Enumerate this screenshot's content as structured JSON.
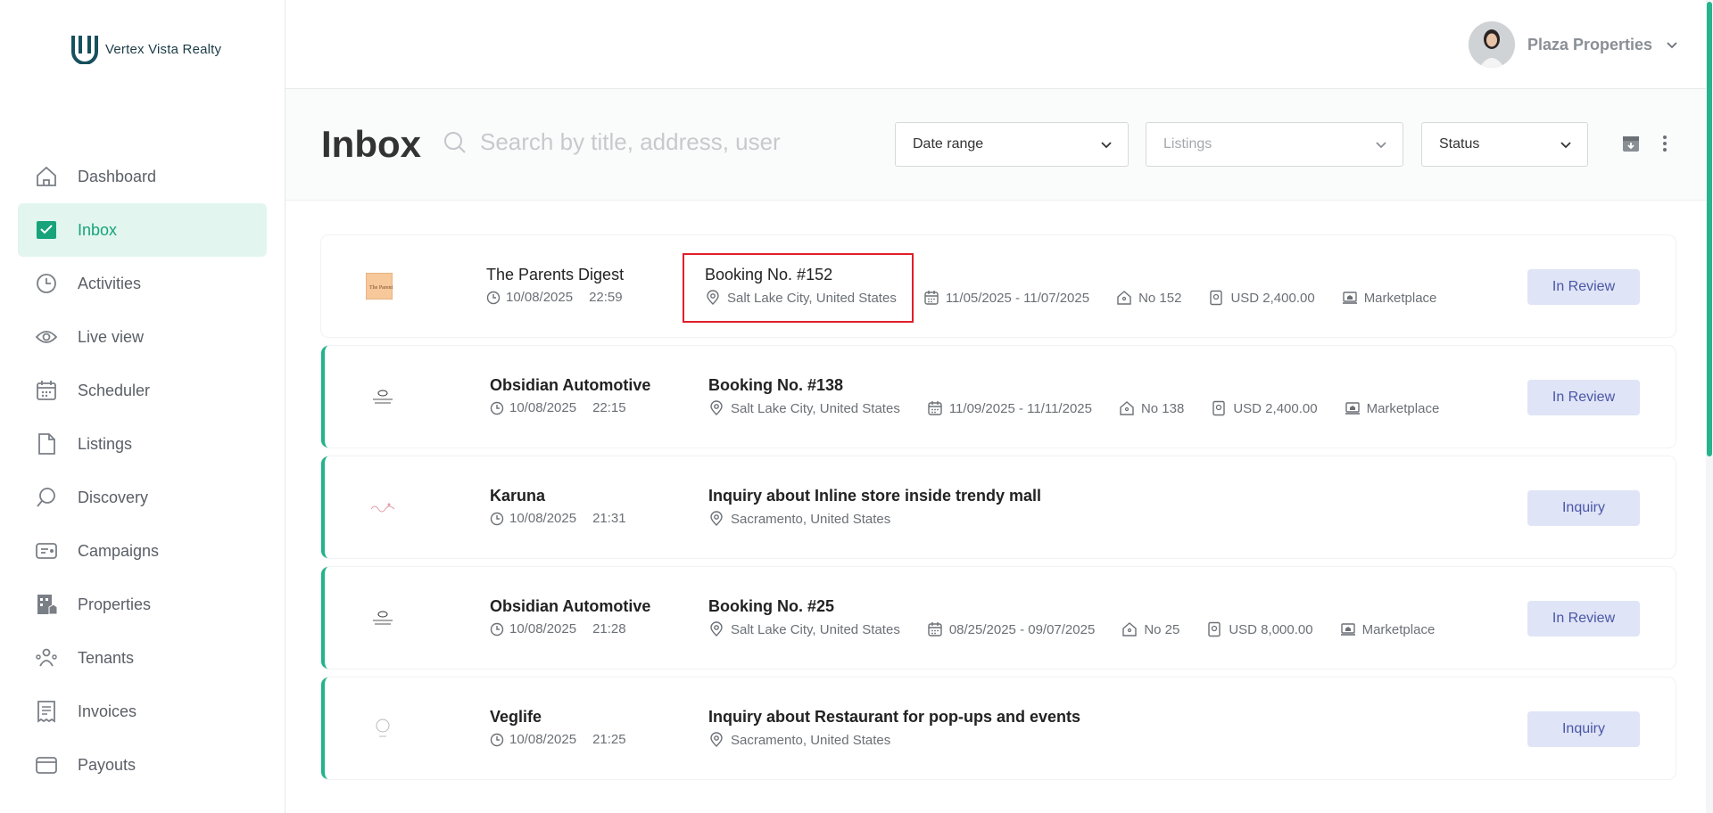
{
  "brand": {
    "name": "Vertex Vista Realty",
    "accent": "#21b48b"
  },
  "sidebar": {
    "items": [
      {
        "label": "Dashboard",
        "icon": "home-icon"
      },
      {
        "label": "Inbox",
        "icon": "mail-check-icon",
        "active": true
      },
      {
        "label": "Activities",
        "icon": "clock-icon"
      },
      {
        "label": "Live view",
        "icon": "eye-icon"
      },
      {
        "label": "Scheduler",
        "icon": "calendar-icon"
      },
      {
        "label": "Listings",
        "icon": "document-icon"
      },
      {
        "label": "Discovery",
        "icon": "search-chat-icon"
      },
      {
        "label": "Campaigns",
        "icon": "campaign-icon"
      },
      {
        "label": "Properties",
        "icon": "building-icon"
      },
      {
        "label": "Tenants",
        "icon": "users-icon"
      },
      {
        "label": "Invoices",
        "icon": "receipt-icon"
      },
      {
        "label": "Payouts",
        "icon": "wallet-icon"
      }
    ]
  },
  "topbar": {
    "user_name": "Plaza Properties"
  },
  "header": {
    "title": "Inbox",
    "search_placeholder": "Search by title, address, user",
    "date_range_label": "Date range",
    "listings_placeholder": "Listings",
    "status_label": "Status"
  },
  "messages": [
    {
      "sender": "The Parents Digest",
      "date": "10/08/2025",
      "time": "22:59",
      "title": "Booking No. #152",
      "location": "Salt Lake City, United States",
      "dates": "11/05/2025 - 11/07/2025",
      "number": "No 152",
      "amount": "USD 2,400.00",
      "channel": "Marketplace",
      "status": "In Review",
      "unread": false,
      "thumb": "parents-digest-logo"
    },
    {
      "sender": "Obsidian Automotive",
      "date": "10/08/2025",
      "time": "22:15",
      "title": "Booking No. #138",
      "location": "Salt Lake City, United States",
      "dates": "11/09/2025 - 11/11/2025",
      "number": "No 138",
      "amount": "USD 2,400.00",
      "channel": "Marketplace",
      "status": "In Review",
      "unread": true,
      "thumb": "obsidian-logo"
    },
    {
      "sender": "Karuna",
      "date": "10/08/2025",
      "time": "21:31",
      "title": "Inquiry about Inline store inside trendy mall",
      "location": "Sacramento, United States",
      "status": "Inquiry",
      "unread": true,
      "thumb": "karuna-logo"
    },
    {
      "sender": "Obsidian Automotive",
      "date": "10/08/2025",
      "time": "21:28",
      "title": "Booking No. #25",
      "location": "Salt Lake City, United States",
      "dates": "08/25/2025 - 09/07/2025",
      "number": "No 25",
      "amount": "USD 8,000.00",
      "channel": "Marketplace",
      "status": "In Review",
      "unread": true,
      "thumb": "obsidian-logo"
    },
    {
      "sender": "Veglife",
      "date": "10/08/2025",
      "time": "21:25",
      "title": "Inquiry about Restaurant for pop-ups and events",
      "location": "Sacramento, United States",
      "status": "Inquiry",
      "unread": true,
      "thumb": "veglife-logo"
    }
  ]
}
